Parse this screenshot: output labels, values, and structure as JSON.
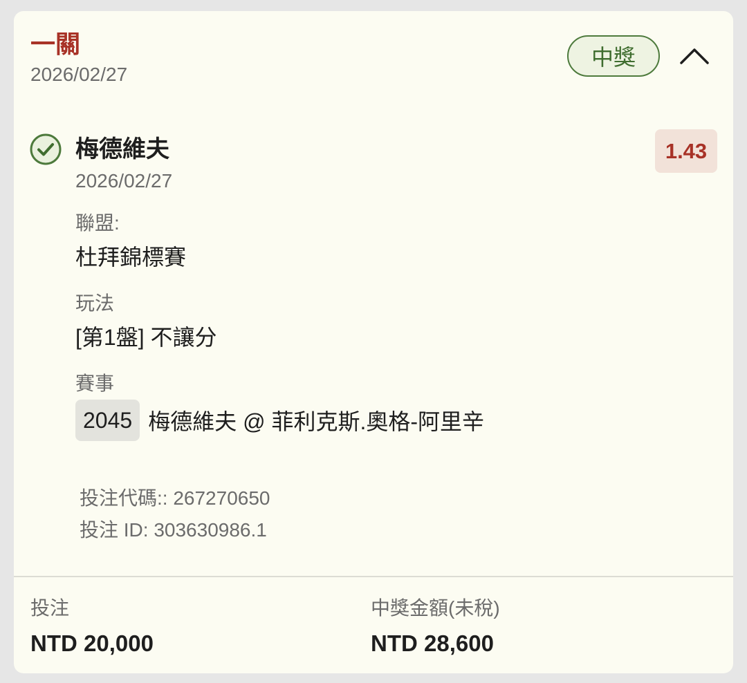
{
  "header": {
    "bet_type": "一關",
    "date": "2026/02/27",
    "status": "中獎"
  },
  "selection": {
    "name": "梅德維夫",
    "date": "2026/02/27",
    "odds": "1.43",
    "league_label": "聯盟:",
    "league": "杜拜錦標賽",
    "market_label": "玩法",
    "market": "[第1盤] 不讓分",
    "event_label": "賽事",
    "event_number": "2045",
    "event_name": "梅德維夫 @ 菲利克斯.奧格-阿里辛"
  },
  "meta": {
    "bet_code": "投注代碼:: 267270650",
    "bet_id": "投注 ID: 303630986.1"
  },
  "summary": {
    "stake_label": "投注",
    "stake_value": "NTD 20,000",
    "payout_label": "中獎金額(未稅)",
    "payout_value": "NTD 28,600"
  },
  "colors": {
    "accent_red": "#a83227",
    "win_green": "#3f6d2f",
    "card_bg": "#fcfcf2"
  },
  "icons": {
    "check": "check-circle-icon",
    "collapse": "chevron-up-icon"
  }
}
